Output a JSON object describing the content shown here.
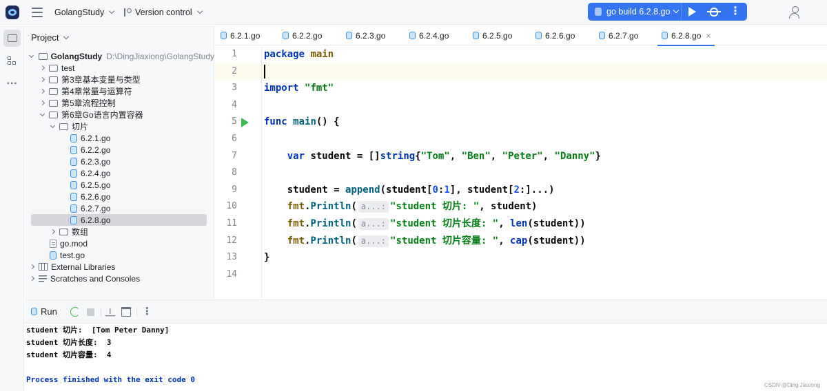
{
  "topbar": {
    "project_name": "GolangStudy",
    "vcs_label": "Version control",
    "run_config": "go build 6.2.8.go"
  },
  "panel": {
    "title": "Project",
    "tree": [
      {
        "label": "GolangStudy",
        "hint": "D:\\DingJiaxiong\\GolangStudy"
      },
      {
        "label": "test"
      },
      {
        "label": "第3章基本变量与类型"
      },
      {
        "label": "第4章常量与运算符"
      },
      {
        "label": "第5章流程控制"
      },
      {
        "label": "第6章Go语言内置容器"
      },
      {
        "label": "切片"
      },
      {
        "label": "6.2.1.go"
      },
      {
        "label": "6.2.2.go"
      },
      {
        "label": "6.2.3.go"
      },
      {
        "label": "6.2.4.go"
      },
      {
        "label": "6.2.5.go"
      },
      {
        "label": "6.2.6.go"
      },
      {
        "label": "6.2.7.go"
      },
      {
        "label": "6.2.8.go"
      },
      {
        "label": "数组"
      },
      {
        "label": "go.mod"
      },
      {
        "label": "test.go"
      },
      {
        "label": "External Libraries"
      },
      {
        "label": "Scratches and Consoles"
      }
    ]
  },
  "tabs": [
    "6.2.1.go",
    "6.2.2.go",
    "6.2.3.go",
    "6.2.4.go",
    "6.2.5.go",
    "6.2.6.go",
    "6.2.7.go",
    "6.2.8.go"
  ],
  "editor": {
    "line_numbers": [
      "1",
      "2",
      "3",
      "4",
      "5",
      "6",
      "7",
      "8",
      "9",
      "10",
      "11",
      "12",
      "13",
      "14"
    ],
    "code": {
      "kw_package": "package",
      "pkg_main": "main",
      "kw_import": "import",
      "str_fmt": "\"fmt\"",
      "kw_func": "func",
      "fn_main": "main",
      "paren_open": "() {",
      "kw_var": "var",
      "var_decl": "student = []",
      "type_string": "string",
      "str_tom": "\"Tom\"",
      "str_ben": "\"Ben\"",
      "str_peter": "\"Peter\"",
      "str_danny": "\"Danny\"",
      "l9_a": "student = ",
      "fn_append": "append",
      "l9_b": "(student[",
      "n0": "0",
      "colon": ":",
      "n1": "1",
      "l9_c": "], student[",
      "n2": "2",
      "l9_d": ":]...)",
      "pkg_fmt": "fmt",
      "fn_println": "Println",
      "hint": "a...:",
      "str_slice": "\"student 切片: \"",
      "arg_student": ", student)",
      "str_len": "\"student 切片长度: \"",
      "fn_len": "len",
      "arg_len": "(student))",
      "str_cap": "\"student 切片容量: \"",
      "fn_cap": "cap",
      "brace_close": "}"
    }
  },
  "run": {
    "tab_label": "Run",
    "output": [
      "student 切片:  [Tom Peter Danny]",
      "student 切片长度:  3",
      "student 切片容量:  4",
      "",
      "Process finished with the exit code 0"
    ]
  },
  "watermark": "CSDN @Ding Jiaxiong"
}
